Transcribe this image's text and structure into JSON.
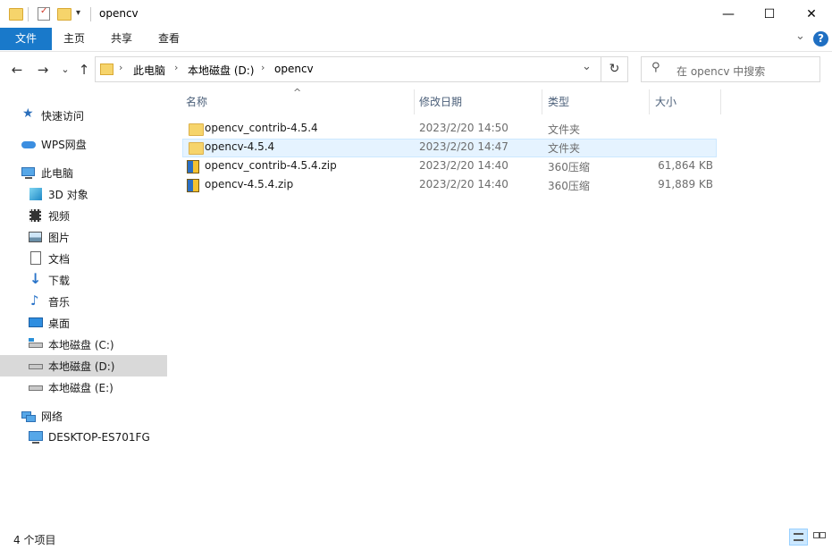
{
  "window": {
    "title": "opencv",
    "minimize_label": "—",
    "maximize_label": "☐",
    "close_label": "✕"
  },
  "ribbon": {
    "tabs": [
      "文件",
      "主页",
      "共享",
      "查看"
    ],
    "expand_label": "⌄",
    "help_label": "?"
  },
  "address": {
    "segments": [
      "此电脑",
      "本地磁盘 (D:)",
      "opencv"
    ],
    "dropdown_label": "⌄",
    "refresh_label": "↻"
  },
  "search": {
    "placeholder": "在 opencv 中搜索"
  },
  "nav": {
    "back": "←",
    "forward": "→",
    "recent": "⌄",
    "up": "↑",
    "items": [
      {
        "label": "快速访问",
        "icon": "star-icon"
      },
      {
        "label": "WPS网盘",
        "icon": "cloud-icon"
      },
      {
        "label": "此电脑",
        "icon": "computer-icon"
      },
      {
        "label": "3D 对象",
        "icon": "cube-icon"
      },
      {
        "label": "视频",
        "icon": "video-icon"
      },
      {
        "label": "图片",
        "icon": "picture-icon"
      },
      {
        "label": "文档",
        "icon": "document-icon"
      },
      {
        "label": "下载",
        "icon": "download-icon"
      },
      {
        "label": "音乐",
        "icon": "music-icon"
      },
      {
        "label": "桌面",
        "icon": "desktop-icon"
      },
      {
        "label": "本地磁盘 (C:)",
        "icon": "drive-icon"
      },
      {
        "label": "本地磁盘 (D:)",
        "icon": "drive-icon"
      },
      {
        "label": "本地磁盘 (E:)",
        "icon": "drive-icon"
      },
      {
        "label": "网络",
        "icon": "network-icon"
      },
      {
        "label": "DESKTOP-ES701FG",
        "icon": "monitor-icon"
      }
    ]
  },
  "list": {
    "sort_indicator": "^",
    "columns": [
      "名称",
      "修改日期",
      "类型",
      "大小"
    ],
    "rows": [
      {
        "name": "opencv_contrib-4.5.4",
        "date": "2023/2/20 14:50",
        "type": "文件夹",
        "size": "",
        "icon": "folder-icon"
      },
      {
        "name": "opencv-4.5.4",
        "date": "2023/2/20 14:47",
        "type": "文件夹",
        "size": "",
        "icon": "folder-icon"
      },
      {
        "name": "opencv_contrib-4.5.4.zip",
        "date": "2023/2/20 14:40",
        "type": "360压缩",
        "size": "61,864 KB",
        "icon": "zip-archive-icon"
      },
      {
        "name": "opencv-4.5.4.zip",
        "date": "2023/2/20 14:40",
        "type": "360压缩",
        "size": "91,889 KB",
        "icon": "zip-archive-icon"
      }
    ]
  },
  "status": {
    "item_count": "4 个项目"
  },
  "colors": {
    "accent": "#1979ca",
    "selected_row": "#e5f3ff",
    "selected_nav": "#d9d9d9",
    "folder": "#f6d46b"
  }
}
